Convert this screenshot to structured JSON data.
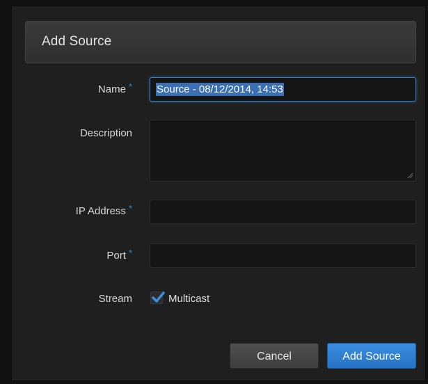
{
  "dialog": {
    "title": "Add Source"
  },
  "form": {
    "name": {
      "label": "Name",
      "required_marker": "*",
      "value": "Source - 08/12/2014, 14:53"
    },
    "description": {
      "label": "Description",
      "value": ""
    },
    "ip_address": {
      "label": "IP Address",
      "required_marker": "*",
      "value": ""
    },
    "port": {
      "label": "Port",
      "required_marker": "*",
      "value": ""
    },
    "stream": {
      "label": "Stream",
      "multicast_label": "Multicast",
      "multicast_checked": true
    }
  },
  "buttons": {
    "cancel": "Cancel",
    "submit": "Add Source"
  },
  "colors": {
    "accent": "#2a8fe0",
    "primary_button": "#2f80d4",
    "background": "#1f1f1f"
  },
  "icons": {
    "checkbox": "checkmark-icon",
    "resize": "resize-grip-icon"
  }
}
